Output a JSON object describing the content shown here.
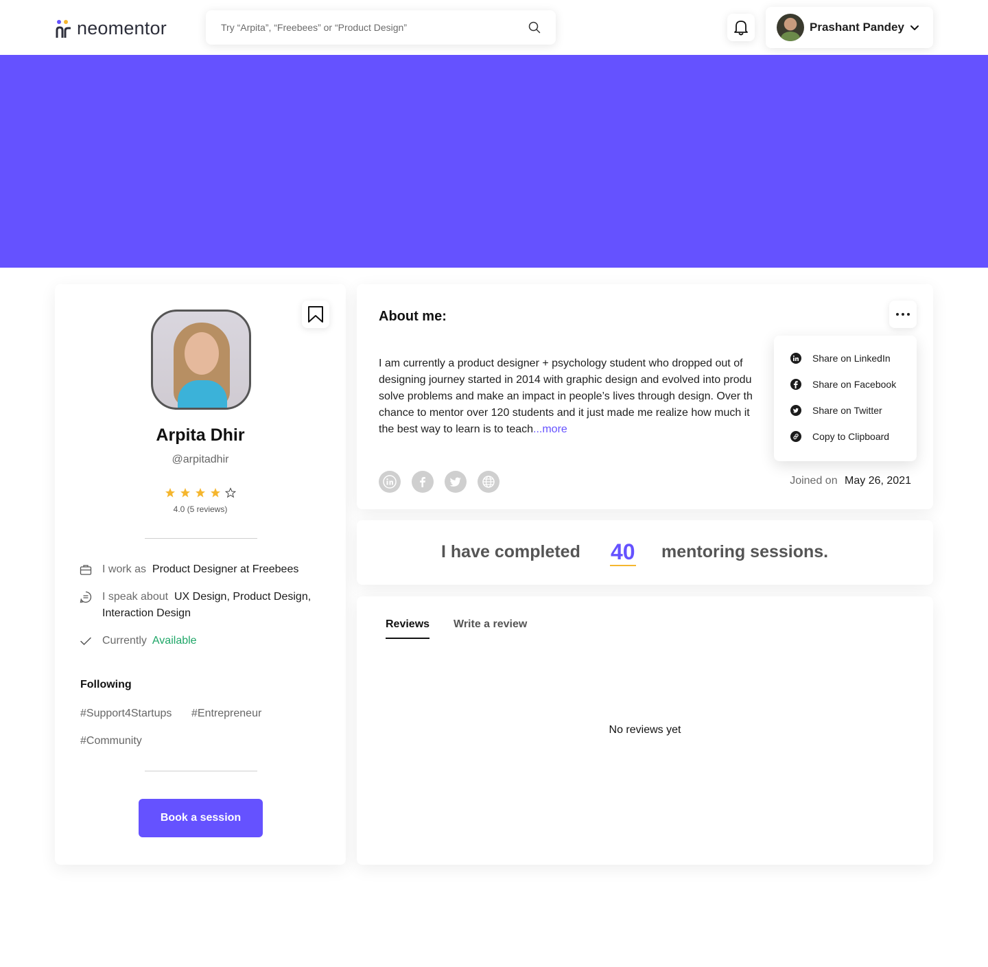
{
  "header": {
    "logo_text": "neomentor",
    "search_placeholder": "Try “Arpita”, “Freebees” or “Product Design”",
    "user_name": "Prashant Pandey"
  },
  "colors": {
    "brand": "#6552ff",
    "accent": "#f5b62e",
    "available": "#1ea667"
  },
  "profile": {
    "name": "Arpita Dhir",
    "handle": "@arpitadhir",
    "rating_stars": 4,
    "rating_max": 5,
    "rating_text": "4.0 (5 reviews)",
    "work_label": "I work as",
    "work_value": "Product Designer at Freebees",
    "speak_label": "I speak about",
    "speak_value_line1": "UX Design, Product Design,",
    "speak_value_line2": "Interaction Design",
    "status_label": "Currently",
    "status_value": "Available",
    "following_title": "Following",
    "tags": [
      "#Support4Startups",
      "#Entrepreneur",
      "#Community"
    ],
    "book_button": "Book a session"
  },
  "about": {
    "title": "About me:",
    "lines": [
      "I am currently a product designer + psychology student who dropped out of",
      "designing journey started in 2014 with graphic design and evolved into produ",
      "solve problems and make an impact in people’s lives through design. Over th",
      "chance to mentor over 120 students and it just made me realize how much it",
      "the best way to learn is to teach"
    ],
    "more_link": "...more",
    "joined_label": "Joined on",
    "joined_date": "May 26, 2021",
    "socials": [
      "linkedin-icon",
      "facebook-icon",
      "twitter-icon",
      "globe-icon"
    ]
  },
  "share_menu": {
    "items": [
      "Share on LinkedIn",
      "Share on Facebook",
      "Share on Twitter",
      "Copy to Clipboard"
    ]
  },
  "sessions": {
    "prefix": "I have completed",
    "count": "40",
    "suffix": "mentoring sessions."
  },
  "reviews": {
    "tabs": [
      "Reviews",
      "Write a review"
    ],
    "empty_text": "No reviews yet"
  }
}
